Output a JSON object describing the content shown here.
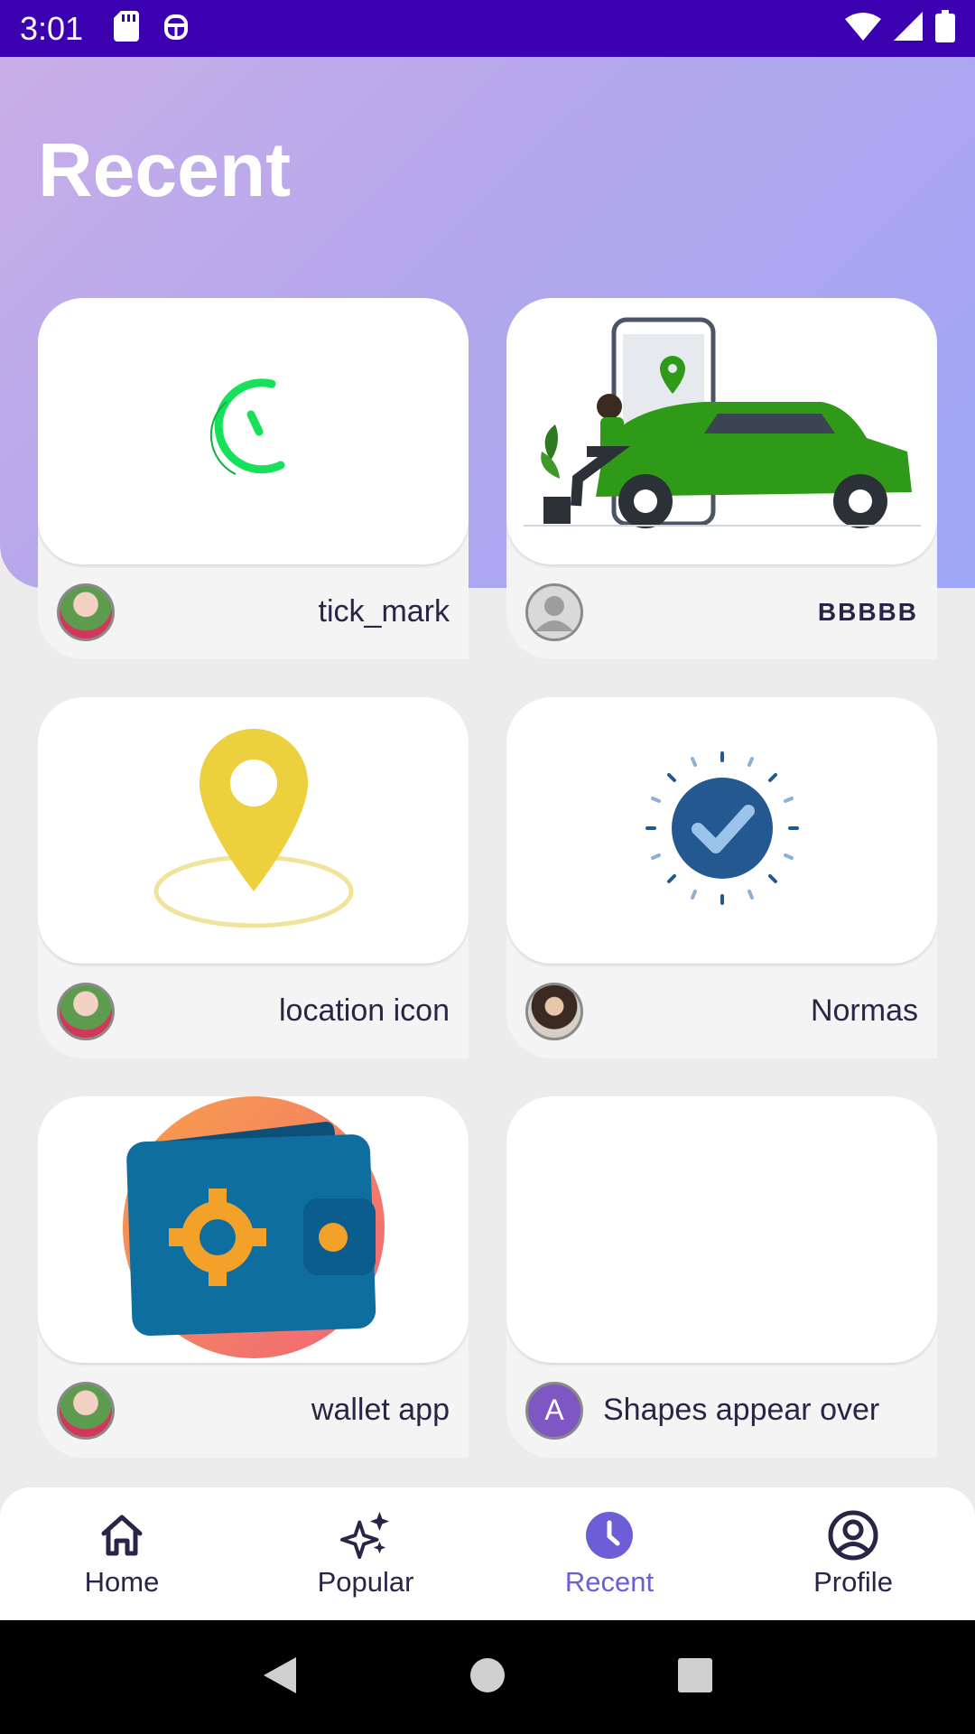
{
  "status_bar": {
    "time": "3:01",
    "icons": [
      "sd-card-icon",
      "debug-icon",
      "wifi-icon",
      "signal-icon",
      "battery-icon"
    ]
  },
  "header": {
    "title": "Recent",
    "gradient_colors": [
      "#c8aee8",
      "#9ea6f6"
    ]
  },
  "cards": [
    {
      "title": "tick_mark",
      "image": "loading-arc-icon",
      "avatar": "child-photo-avatar"
    },
    {
      "title": "BBBBB",
      "image": "car-location-illustration",
      "avatar": "default-user-avatar"
    },
    {
      "title": "location icon",
      "image": "location-pin-icon",
      "avatar": "child-photo-avatar"
    },
    {
      "title": "Normas",
      "image": "verified-check-icon",
      "avatar": "woman-photo-avatar"
    },
    {
      "title": "wallet app",
      "image": "wallet-gear-icon",
      "avatar": "child-photo-avatar"
    },
    {
      "title": "Shapes appear over",
      "image": "",
      "avatar_letter": "A",
      "avatar_color": "#7e57c2"
    }
  ],
  "bottom_nav": {
    "items": [
      {
        "label": "Home",
        "icon": "home-icon",
        "active": false
      },
      {
        "label": "Popular",
        "icon": "sparkle-icon",
        "active": false
      },
      {
        "label": "Recent",
        "icon": "clock-icon",
        "active": true
      },
      {
        "label": "Profile",
        "icon": "profile-icon",
        "active": false
      }
    ],
    "active_color": "#6c5ed6"
  },
  "system_nav": [
    "back-button",
    "home-button",
    "recents-button"
  ]
}
